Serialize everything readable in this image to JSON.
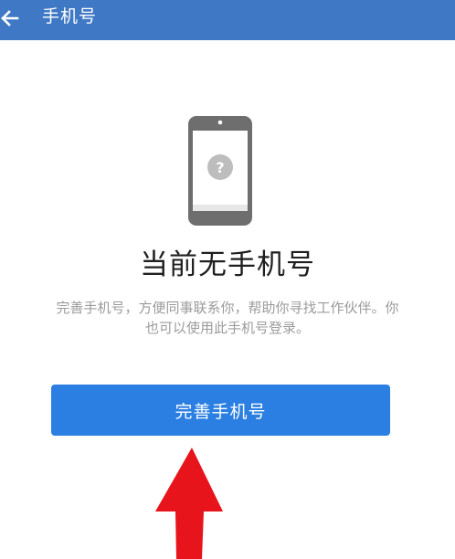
{
  "appbar": {
    "title": "手机号",
    "back_icon": "arrow-left-icon",
    "background": "#3f78c5"
  },
  "illustration": {
    "icon": "phone-question-icon",
    "question_mark": "?"
  },
  "main": {
    "headline": "当前无手机号",
    "description_line1": "完善手机号，方便同事联系你，帮助你寻找工作伙伴。你",
    "description_line2": "也可以使用此手机号登录。",
    "cta_label": "完善手机号",
    "cta_color": "#2b7fe2"
  },
  "annotation": {
    "arrow_icon": "red-arrow-up-icon",
    "arrow_color": "#e8141c"
  }
}
